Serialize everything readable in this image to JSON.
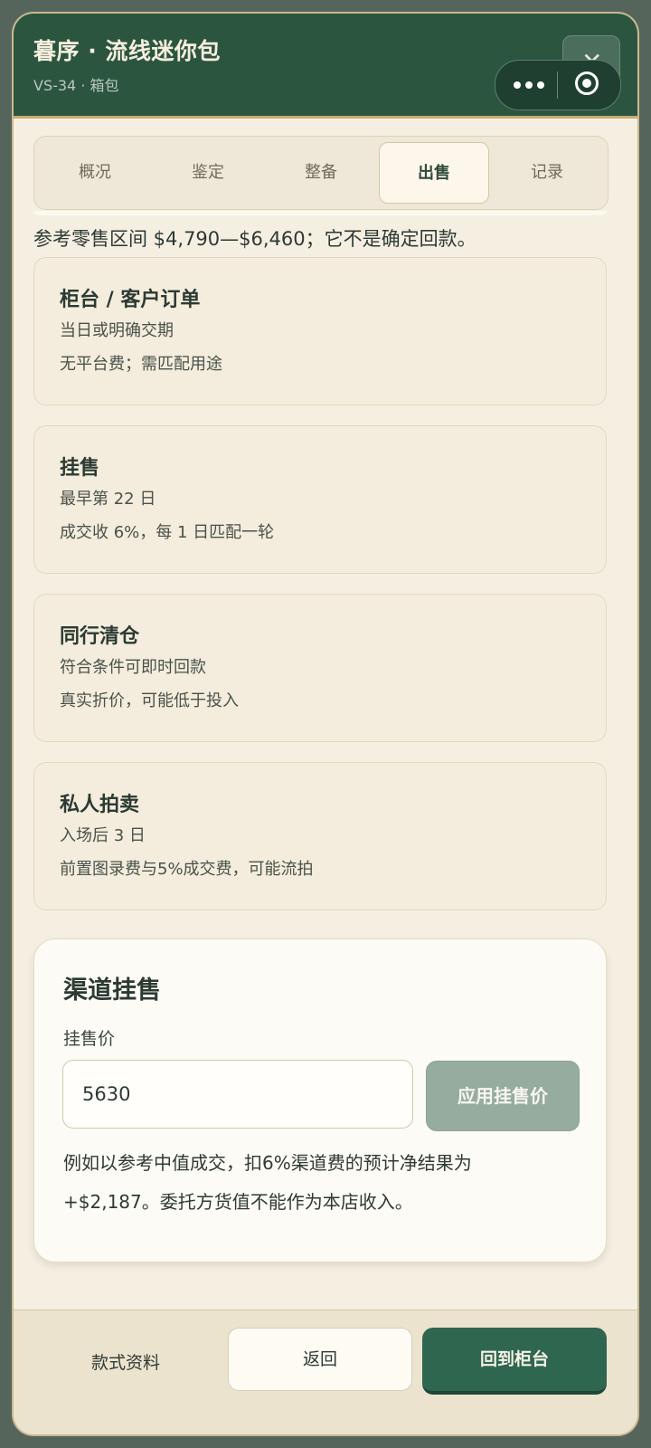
{
  "header": {
    "title": "暮序 · 流线迷你包",
    "subtitle": "VS-34 · 箱包",
    "close_icon": "close-icon",
    "more_icon": "more-dots-icon",
    "target_icon": "target-icon"
  },
  "tabs": [
    {
      "label": "概况",
      "active": false
    },
    {
      "label": "鉴定",
      "active": false
    },
    {
      "label": "整备",
      "active": false
    },
    {
      "label": "出售",
      "active": true
    },
    {
      "label": "记录",
      "active": false
    }
  ],
  "hint": "参考零售区间 $4,790—$6,460；它不是确定回款。",
  "channels": [
    {
      "title": "柜台 / 客户订单",
      "line1": "当日或明确交期",
      "line2": "无平台费；需匹配用途"
    },
    {
      "title": "挂售",
      "line1": "最早第 22 日",
      "line2": "成交收 6%，每 1 日匹配一轮"
    },
    {
      "title": "同行清仓",
      "line1": "符合条件可即时回款",
      "line2": "真实折价，可能低于投入"
    },
    {
      "title": "私人拍卖",
      "line1": "入场后 3 日",
      "line2": "前置图录费与5%成交费，可能流拍"
    }
  ],
  "listing": {
    "title": "渠道挂售",
    "price_label": "挂售价",
    "price_value": "5630",
    "apply_label": "应用挂售价",
    "note": "例如以参考中值成交，扣6%渠道费的预计净结果为 +$2,187。委托方货值不能作为本店收入。"
  },
  "footer": {
    "info_label": "款式资料",
    "back_label": "返回",
    "primary_label": "回到柜台"
  },
  "colors": {
    "header_bg": "#2c5540",
    "accent_gold": "#c8ad6e",
    "primary_button": "#2f6650",
    "disabled_button": "#96ac9f",
    "card_bg": "#f4ecdc"
  }
}
